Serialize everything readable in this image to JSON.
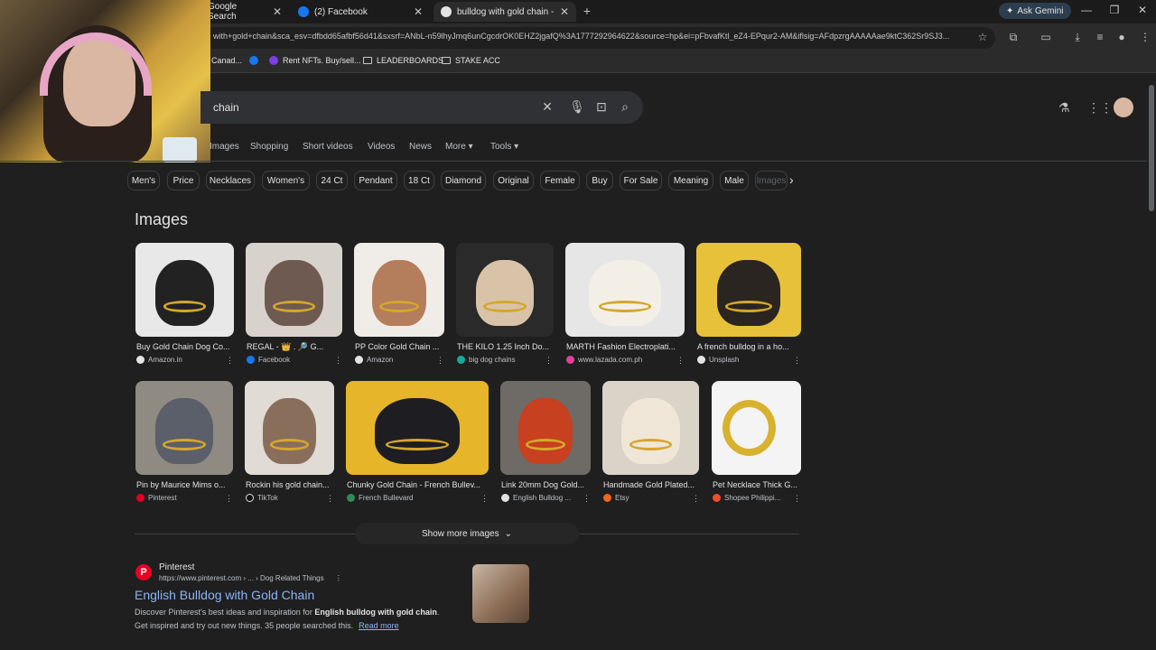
{
  "browser": {
    "tabs": [
      {
        "label": "Google Search"
      },
      {
        "label": "(2) Facebook"
      },
      {
        "label": "bulldog with gold chain - Goog"
      }
    ],
    "new_tab_symbol": "+",
    "close_symbol": "✕",
    "gemini_label": "Ask Gemini",
    "url": "with+gold+chain&sca_esv=dfbdd65afbf56d41&sxsrf=ANbL-n59lhyJmq6unCgcdrOK0EHZ2jgafQ%3A1777292964622&source=hp&ei=pFbvafKtl_eZ4-EPqur2-AM&iflsig=AFdpzrgAAAAAae9ktC362Sr9SJ3...",
    "bookmarks": [
      {
        "label": "Canad..."
      },
      {
        "label": "Rent NFTs. Buy/sell..."
      },
      {
        "label": "LEADERBOARDS"
      },
      {
        "label": "STAKE ACC"
      }
    ]
  },
  "search": {
    "query_visible": "chain"
  },
  "nav_tabs": [
    "Images",
    "Shopping",
    "Short videos",
    "Videos",
    "News",
    "More",
    "Tools"
  ],
  "chips": [
    "Men's",
    "Price",
    "Necklaces",
    "Women's",
    "24 Ct",
    "Pendant",
    "18 Ct",
    "Diamond",
    "Original",
    "Female",
    "Buy",
    "For Sale",
    "Meaning",
    "Male",
    "Images"
  ],
  "images_section": {
    "title": "Images",
    "row1": [
      {
        "caption": "Buy Gold Chain Dog Co...",
        "source": "Amazon.in"
      },
      {
        "caption": "REGAL - 👑 . 🔎 G...",
        "source": "Facebook"
      },
      {
        "caption": "PP Color Gold Chain ...",
        "source": "Amazon"
      },
      {
        "caption": "THE KILO 1.25 Inch Do...",
        "source": "big dog chains"
      },
      {
        "caption": "MARTH Fashion Electroplati...",
        "source": "www.lazada.com.ph"
      },
      {
        "caption": "A french bulldog in a ho...",
        "source": "Unsplash"
      }
    ],
    "row2": [
      {
        "caption": "Pin by Maurice Mims o...",
        "source": "Pinterest"
      },
      {
        "caption": "Rockin his gold chain...",
        "source": "TikTok"
      },
      {
        "caption": "Chunky Gold Chain - French Bullev...",
        "source": "French Bullevard"
      },
      {
        "caption": "Link 20mm Dog Gold...",
        "source": "English Bulldog ..."
      },
      {
        "caption": "Handmade Gold Plated...",
        "source": "Etsy"
      },
      {
        "caption": "Pet Necklace Thick G...",
        "source": "Shopee Philippi..."
      }
    ],
    "show_more_label": "Show more images"
  },
  "result": {
    "site": "Pinterest",
    "url": "https://www.pinterest.com › ... › Dog Related Things",
    "title": "English Bulldog with Gold Chain",
    "snippet_pre": "Discover Pinterest's best ideas and inspiration for ",
    "snippet_bold": "English bulldog with gold chain",
    "snippet_post": ".",
    "snippet_line2": "Get inspired and try out new things. 35 people searched this.",
    "read_more": "Read more"
  },
  "colors": {
    "background": "#1f1f1f",
    "link": "#8ab4f8",
    "text": "#e3e3e3",
    "muted": "#bdc1c6"
  }
}
